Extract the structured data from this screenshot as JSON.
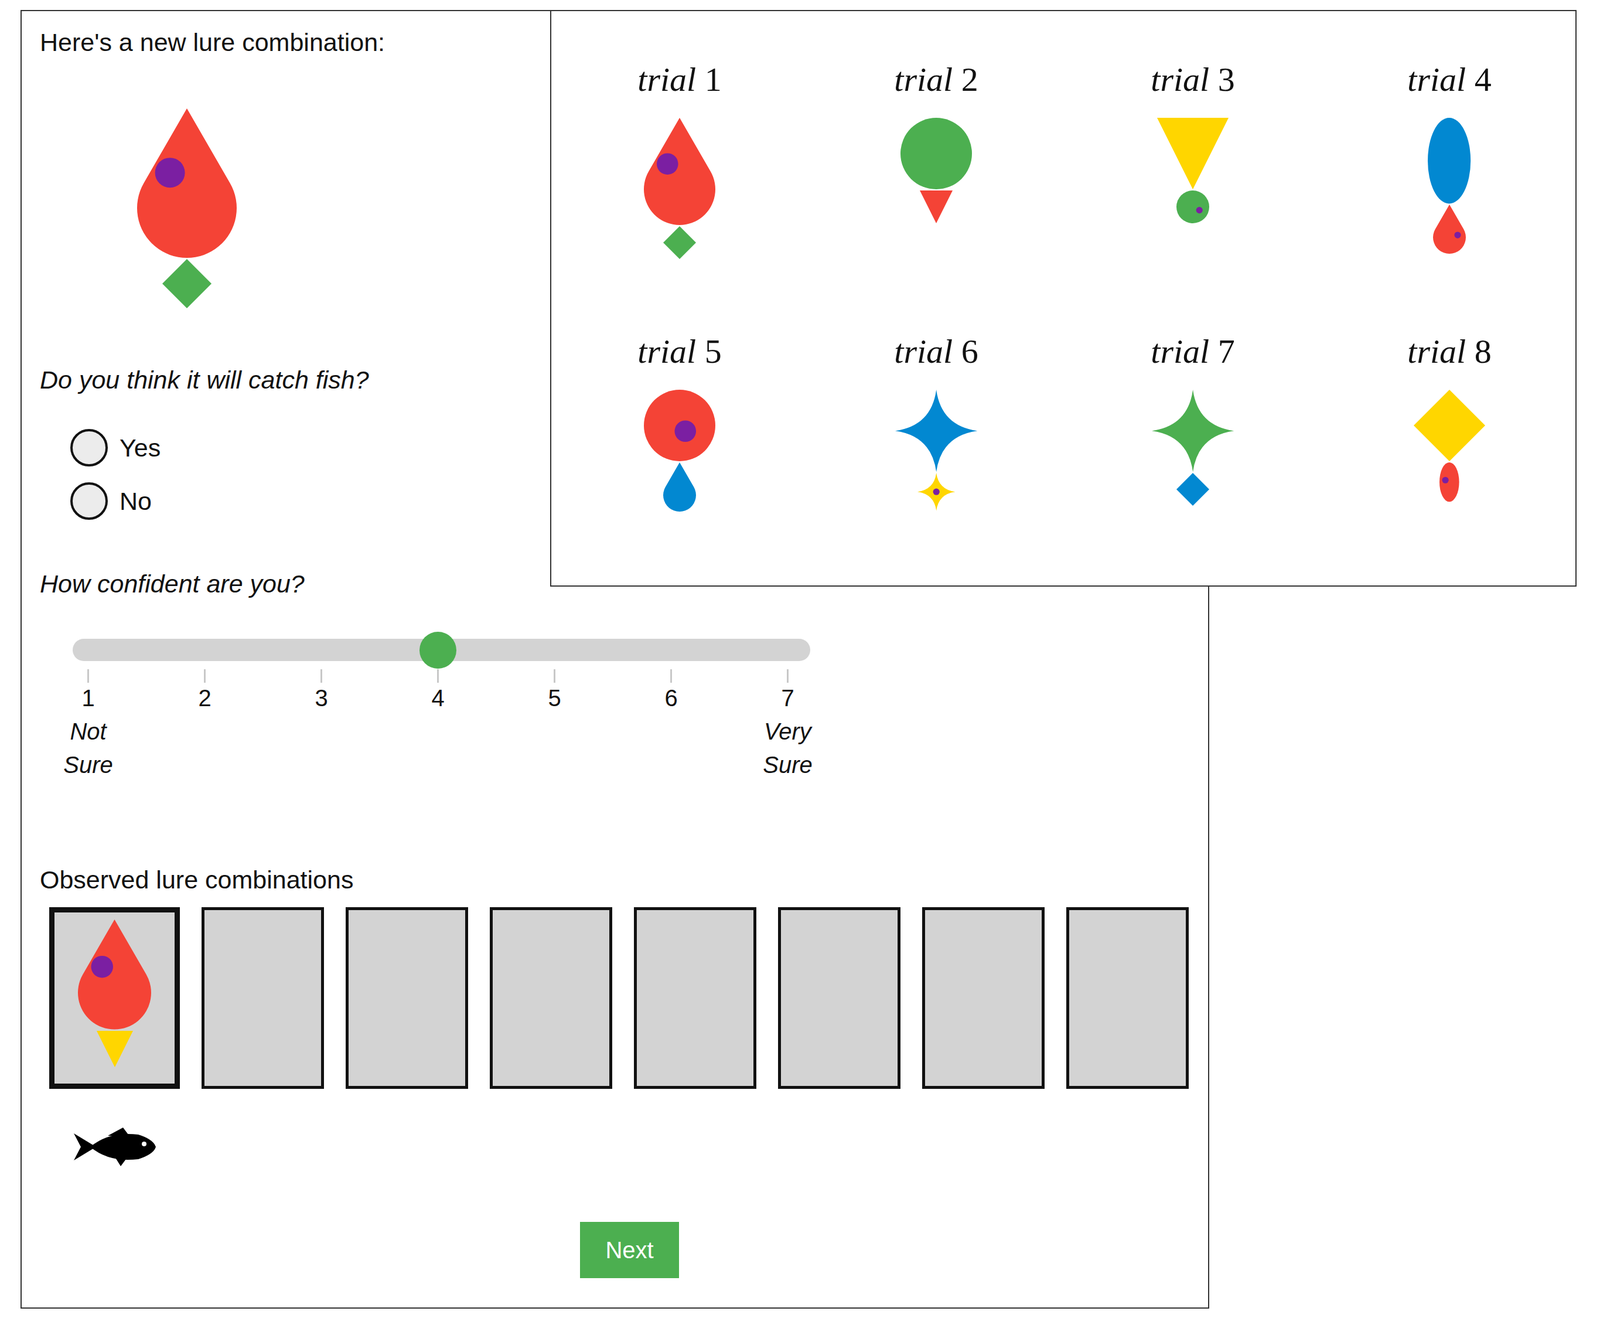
{
  "prompt": {
    "title": "Here's a new lure combination:",
    "lure": {
      "top": {
        "kind": "drop",
        "color": "#f44336",
        "dot": true
      },
      "bottom": {
        "kind": "diamond",
        "color": "#4caf50",
        "dot": false
      }
    }
  },
  "question": {
    "label": "Do you think it will catch fish?",
    "options": [
      {
        "label": "Yes",
        "selected": false
      },
      {
        "label": "No",
        "selected": false
      }
    ]
  },
  "confidence": {
    "label": "How confident are you?",
    "level": 0.5,
    "ticks": [
      {
        "value": "1",
        "note": "Not Sure"
      },
      {
        "value": "2"
      },
      {
        "value": "3"
      },
      {
        "value": "4"
      },
      {
        "value": "5"
      },
      {
        "value": "6"
      },
      {
        "value": "7",
        "note": "Very Sure"
      }
    ]
  },
  "observed": {
    "title": "Observed lure combinations",
    "slots": [
      {
        "current": true,
        "caught": true,
        "lure": {
          "top": {
            "kind": "drop",
            "color": "#f44336",
            "dot": true
          },
          "bottom": {
            "kind": "triangle",
            "color": "#ffd600",
            "dot": false
          }
        }
      },
      {
        "current": false,
        "caught": false
      },
      {
        "current": false,
        "caught": false
      },
      {
        "current": false,
        "caught": false
      },
      {
        "current": false,
        "caught": false
      },
      {
        "current": false,
        "caught": false
      },
      {
        "current": false,
        "caught": false
      },
      {
        "current": false,
        "caught": false
      }
    ]
  },
  "buttons": [
    "Next"
  ],
  "trials": [
    {
      "word": "trial",
      "number": "1",
      "lure": {
        "top": {
          "kind": "drop",
          "color": "#f44336",
          "dot": true
        },
        "bottom": {
          "kind": "diamond",
          "color": "#4caf50",
          "dot": false
        }
      }
    },
    {
      "word": "trial",
      "number": "2",
      "lure": {
        "top": {
          "kind": "circle",
          "color": "#4caf50",
          "dot": false
        },
        "bottom": {
          "kind": "triangle",
          "color": "#f44336",
          "dot": false
        }
      }
    },
    {
      "word": "trial",
      "number": "3",
      "lure": {
        "top": {
          "kind": "triangle",
          "color": "#ffd600",
          "dot": false
        },
        "bottom": {
          "kind": "circle",
          "color": "#4caf50",
          "dot": true
        }
      }
    },
    {
      "word": "trial",
      "number": "4",
      "lure": {
        "top": {
          "kind": "ellipse",
          "color": "#0288d1",
          "dot": false
        },
        "bottom": {
          "kind": "drop",
          "color": "#f44336",
          "dot": true
        }
      }
    },
    {
      "word": "trial",
      "number": "5",
      "lure": {
        "top": {
          "kind": "circle",
          "color": "#f44336",
          "dot": true
        },
        "bottom": {
          "kind": "drop",
          "color": "#0288d1",
          "dot": false
        }
      }
    },
    {
      "word": "trial",
      "number": "6",
      "lure": {
        "top": {
          "kind": "star",
          "color": "#0288d1",
          "dot": false
        },
        "bottom": {
          "kind": "star",
          "color": "#ffd600",
          "dot": true
        }
      }
    },
    {
      "word": "trial",
      "number": "7",
      "lure": {
        "top": {
          "kind": "star",
          "color": "#4caf50",
          "dot": false
        },
        "bottom": {
          "kind": "diamond",
          "color": "#0288d1",
          "dot": false
        }
      }
    },
    {
      "word": "trial",
      "number": "8",
      "lure": {
        "top": {
          "kind": "diamond",
          "color": "#ffd600",
          "dot": false
        },
        "bottom": {
          "kind": "ellipse",
          "color": "#f44336",
          "dot": true
        }
      }
    }
  ]
}
